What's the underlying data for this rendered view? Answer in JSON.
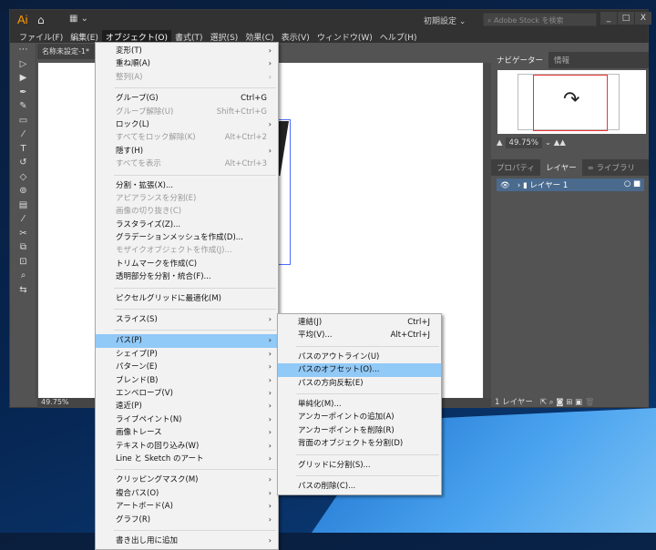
{
  "app": {
    "logo": "Ai",
    "home_icon": "home-icon",
    "workspace_icon": "workspace-switcher-icon",
    "preset": "初期設定 ⌄",
    "stock_placeholder": "Adobe Stock を検索",
    "minimize": "_",
    "maximize": "□",
    "close": "X"
  },
  "menubar": [
    "ファイル(F)",
    "編集(E)",
    "オブジェクト(O)",
    "書式(T)",
    "選択(S)",
    "効果(C)",
    "表示(V)",
    "ウィンドウ(W)",
    "ヘルプ(H)"
  ],
  "document": {
    "tab": "名称未設定-1*",
    "zoom": "49.75%"
  },
  "object_menu": [
    {
      "label": "変形(T)",
      "sub": true
    },
    {
      "label": "重ね順(A)",
      "sub": true
    },
    {
      "label": "整列(A)",
      "sub": true,
      "disabled": true
    },
    {
      "sep": true
    },
    {
      "label": "グループ(G)",
      "shortcut": "Ctrl+G"
    },
    {
      "label": "グループ解除(U)",
      "shortcut": "Shift+Ctrl+G",
      "disabled": true
    },
    {
      "label": "ロック(L)",
      "sub": true
    },
    {
      "label": "すべてをロック解除(K)",
      "shortcut": "Alt+Ctrl+2",
      "disabled": true
    },
    {
      "label": "隠す(H)",
      "sub": true
    },
    {
      "label": "すべてを表示",
      "shortcut": "Alt+Ctrl+3",
      "disabled": true
    },
    {
      "sep": true
    },
    {
      "label": "分割・拡張(X)..."
    },
    {
      "label": "アピアランスを分割(E)",
      "disabled": true
    },
    {
      "label": "画像の切り抜き(C)",
      "disabled": true
    },
    {
      "label": "ラスタライズ(Z)..."
    },
    {
      "label": "グラデーションメッシュを作成(D)..."
    },
    {
      "label": "モザイクオブジェクトを作成(J)...",
      "disabled": true
    },
    {
      "label": "トリムマークを作成(C)"
    },
    {
      "label": "透明部分を分割・統合(F)..."
    },
    {
      "sep": true
    },
    {
      "label": "ピクセルグリッドに最適化(M)"
    },
    {
      "sep": true
    },
    {
      "label": "スライス(S)",
      "sub": true
    },
    {
      "sep": true
    },
    {
      "label": "パス(P)",
      "sub": true,
      "highlighted": true
    },
    {
      "label": "シェイプ(P)",
      "sub": true
    },
    {
      "label": "パターン(E)",
      "sub": true
    },
    {
      "label": "ブレンド(B)",
      "sub": true
    },
    {
      "label": "エンベロープ(V)",
      "sub": true
    },
    {
      "label": "遠近(P)",
      "sub": true
    },
    {
      "label": "ライブペイント(N)",
      "sub": true
    },
    {
      "label": "画像トレース",
      "sub": true
    },
    {
      "label": "テキストの回り込み(W)",
      "sub": true
    },
    {
      "label": "Line と Sketch のアート",
      "sub": true
    },
    {
      "sep": true
    },
    {
      "label": "クリッピングマスク(M)",
      "sub": true
    },
    {
      "label": "複合パス(O)",
      "sub": true
    },
    {
      "label": "アートボード(A)",
      "sub": true
    },
    {
      "label": "グラフ(R)",
      "sub": true
    },
    {
      "sep": true
    },
    {
      "label": "書き出し用に追加",
      "sub": true
    }
  ],
  "path_menu": [
    {
      "label": "連結(J)",
      "shortcut": "Ctrl+J"
    },
    {
      "label": "平均(V)...",
      "shortcut": "Alt+Ctrl+J"
    },
    {
      "sep": true
    },
    {
      "label": "パスのアウトライン(U)"
    },
    {
      "label": "パスのオフセット(O)...",
      "highlighted": true
    },
    {
      "label": "パスの方向反転(E)"
    },
    {
      "sep": true
    },
    {
      "label": "単純化(M)..."
    },
    {
      "label": "アンカーポイントの追加(A)"
    },
    {
      "label": "アンカーポイントを削除(R)"
    },
    {
      "label": "背面のオブジェクトを分割(D)"
    },
    {
      "sep": true
    },
    {
      "label": "グリッドに分割(S)..."
    },
    {
      "sep": true
    },
    {
      "label": "パスの削除(C)..."
    }
  ],
  "panels": {
    "top_tabs": [
      "ナビゲーター",
      "情報"
    ],
    "nav_zoom": "49.75%",
    "bottom_tabs": [
      "プロパティ",
      "レイヤー",
      "∞ ライブラリ"
    ],
    "layer_name": "レイヤー 1",
    "layer_count": "1 レイヤー"
  },
  "colors": {
    "accent_highlight": "#91c9f7",
    "logo": "#ff9a00",
    "selection": "#4c6bff",
    "nav_view": "#e33333"
  }
}
